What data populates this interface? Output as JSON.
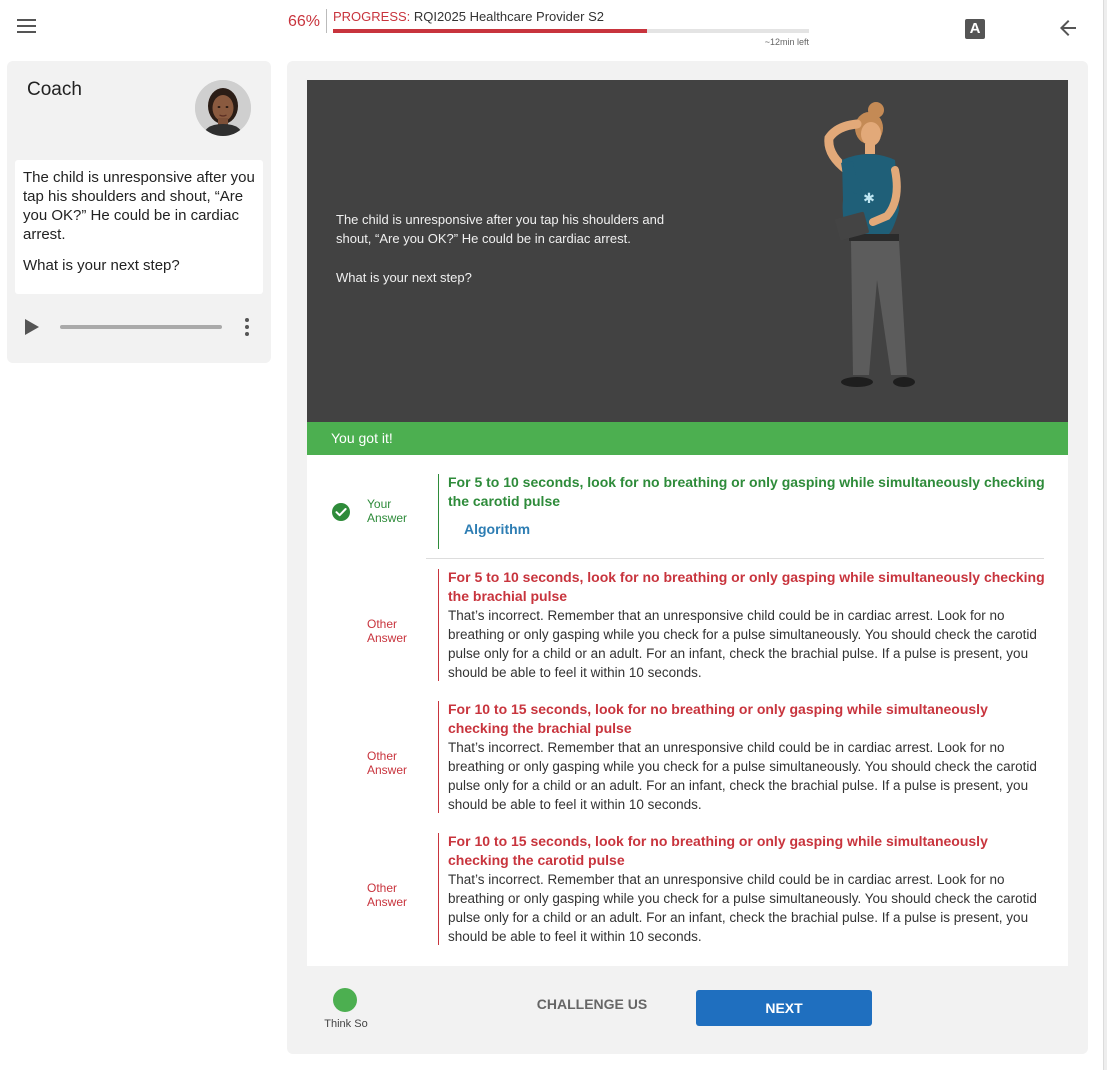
{
  "header": {
    "progress_percent_label": "66%",
    "progress_fraction": 0.66,
    "progress_label": "PROGRESS:",
    "course_name": "RQI2025 Healthcare Provider S2",
    "time_left": "~12min left",
    "font_button_label": "A",
    "icons": {
      "menu": "hamburger-menu-icon",
      "font": "font-size-icon",
      "back": "back-arrow-icon"
    }
  },
  "coach": {
    "title": "Coach",
    "message": "The child is unresponsive after you tap his shoulders and shout, “Are you OK?” He could be in cardiac arrest.",
    "question": "What is your next step?"
  },
  "scene": {
    "message": "The child is unresponsive after you tap his shoulders and shout, “Are you OK?” He could be in cardiac arrest.",
    "question": "What is your next step?"
  },
  "result": {
    "banner": "You got it!"
  },
  "answers": {
    "selected": {
      "tag": "Your Answer",
      "text": "For 5 to 10 seconds, look for no breathing or only gasping while simultaneously checking the carotid pulse",
      "link": "Algorithm"
    },
    "others": [
      {
        "tag": "Other Answer",
        "text": "For 5 to 10 seconds, look for no breathing or only gasping while simultaneously checking the brachial pulse",
        "feedback": "That’s incorrect. Remember that an unresponsive child could be in cardiac arrest. Look for no breathing or only gasping while you check for a pulse simultaneously. You should check the carotid pulse only for a child or an adult. For an infant, check the brachial pulse. If a pulse is present, you should be able to feel it within 10 seconds."
      },
      {
        "tag": "Other Answer",
        "text": "For 10 to 15 seconds, look for no breathing or only gasping while simultaneously checking the brachial pulse",
        "feedback": "That’s incorrect. Remember that an unresponsive child could be in cardiac arrest. Look for no breathing or only gasping while you check for a pulse simultaneously. You should check the carotid pulse only for a child or an adult. For an infant, check the brachial pulse. If a pulse is present, you should be able to feel it within 10 seconds."
      },
      {
        "tag": "Other Answer",
        "text": "For 10 to 15 seconds, look for no breathing or only gasping while simultaneously checking the carotid pulse",
        "feedback": "That’s incorrect. Remember that an unresponsive child could be in cardiac arrest. Look for no breathing or only gasping while you check for a pulse simultaneously. You should check the carotid pulse only for a child or an adult. For an infant, check the brachial pulse. If a pulse is present, you should be able to feel it within 10 seconds."
      }
    ]
  },
  "footer": {
    "think_label": "Think So",
    "challenge_label": "CHALLENGE US",
    "next_label": "NEXT"
  },
  "colors": {
    "accent_red": "#c8343d",
    "success_green": "#4caf50",
    "correct_green": "#2e8b3a",
    "primary_blue": "#1f6fbf",
    "link_blue": "#2d7db3",
    "scene_bg": "#424242"
  }
}
